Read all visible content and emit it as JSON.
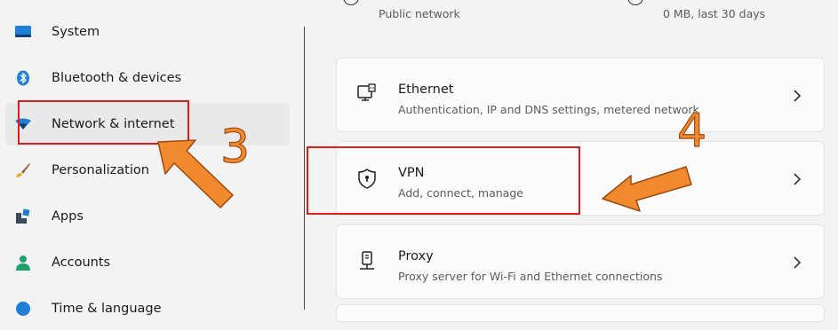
{
  "sidebar": {
    "items": [
      {
        "label": "System",
        "icon": "monitor-icon"
      },
      {
        "label": "Bluetooth & devices",
        "icon": "bluetooth-icon"
      },
      {
        "label": "Network & internet",
        "icon": "network-icon",
        "selected": true
      },
      {
        "label": "Personalization",
        "icon": "brush-icon"
      },
      {
        "label": "Apps",
        "icon": "apps-icon"
      },
      {
        "label": "Accounts",
        "icon": "person-icon"
      },
      {
        "label": "Time & language",
        "icon": "clock-globe-icon"
      }
    ]
  },
  "top_row": {
    "properties_sub": "Public network",
    "data_usage_sub": "0 MB, last 30 days"
  },
  "cards": [
    {
      "title": "Ethernet",
      "subtitle": "Authentication, IP and DNS settings, metered network",
      "icon": "ethernet-icon"
    },
    {
      "title": "VPN",
      "subtitle": "Add, connect, manage",
      "icon": "shield-icon"
    },
    {
      "title": "Proxy",
      "subtitle": "Proxy server for Wi-Fi and Ethernet connections",
      "icon": "proxy-server-icon"
    }
  ],
  "annotations": {
    "step3": "3",
    "step4": "4",
    "highlight_color": "#e21b1b",
    "arrow_color": "#f18a2f"
  }
}
